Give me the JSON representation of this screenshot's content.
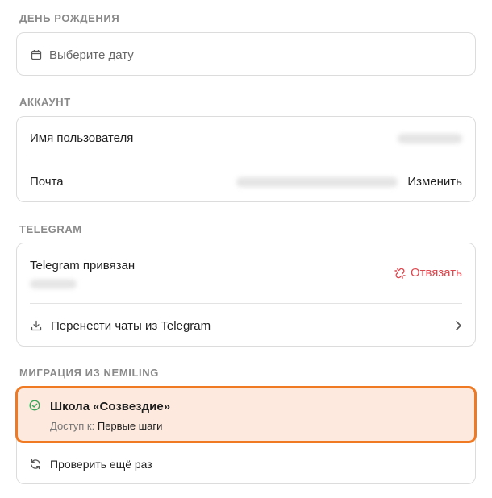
{
  "birthday": {
    "section_title": "ДЕНЬ РОЖДЕНИЯ",
    "date_placeholder": "Выберите дату",
    "icon": "calendar-icon"
  },
  "account": {
    "section_title": "АККАУНТ",
    "username_label": "Имя пользователя",
    "email_label": "Почта",
    "change_label": "Изменить"
  },
  "telegram": {
    "section_title": "TELEGRAM",
    "linked_label": "Telegram привязан",
    "unlink_label": "Отвязать",
    "transfer_label": "Перенести чаты из Telegram",
    "icons": [
      "unlink-icon",
      "download-icon",
      "chevron-right-icon"
    ]
  },
  "migration": {
    "section_title": "МИГРАЦИЯ ИЗ NEMILING",
    "school_name": "Школа «Созвездие»",
    "access_prefix": "Доступ к:",
    "access_value": "Первые шаги",
    "retry_label": "Проверить ещё раз",
    "icons": [
      "check-circle-icon",
      "refresh-icon"
    ]
  },
  "colors": {
    "accent": "#f07a23",
    "highlight_bg": "#fde9dd",
    "danger": "#e0464d",
    "success": "#3aa55a"
  }
}
